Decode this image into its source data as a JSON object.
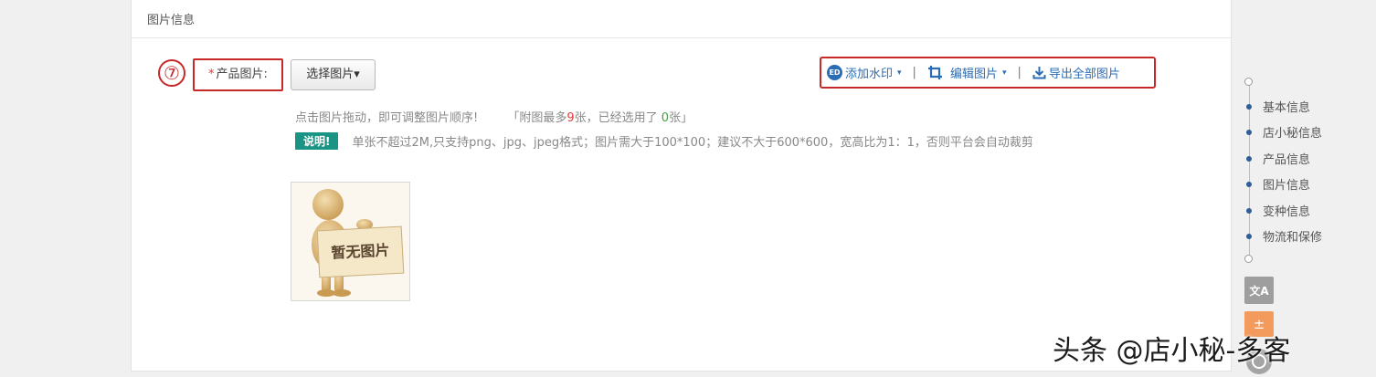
{
  "section": {
    "title": "图片信息"
  },
  "step": {
    "marker": "⑦"
  },
  "field": {
    "required_mark": "*",
    "label": "产品图片:"
  },
  "select_button": {
    "label": "选择图片▾"
  },
  "toolbar": {
    "watermark_icon": "watermark-icon",
    "watermark_label": "添加水印",
    "separator": "|",
    "edit_label": "编辑图片",
    "export_label": "导出全部图片",
    "caret": "▾"
  },
  "hint": {
    "prefix": "点击图片拖动，即可调整图片顺序!",
    "limit_prefix": "「附图最多",
    "max_count": "9",
    "limit_mid": "张，已经选用了 ",
    "used_count": "0",
    "limit_suffix": "张」"
  },
  "note": {
    "badge": "说明!",
    "text": "单张不超过2M,只支持png、jpg、jpeg格式；图片需大于100*100；建议不大于600*600，宽高比为1：1，否则平台会自动裁剪"
  },
  "placeholder_image": {
    "label": "暂无图片"
  },
  "nav": {
    "items": [
      "基本信息",
      "店小秘信息",
      "产品信息",
      "图片信息",
      "变种信息",
      "物流和保修"
    ]
  },
  "side_buttons": {
    "translate_symbol": "文A",
    "calc_symbol": "±"
  },
  "watermark": {
    "text": "头条 @店小秘-多客"
  },
  "colors": {
    "accent": "#2a6db5",
    "highlight": "#c62828",
    "badge": "#1a9585"
  }
}
